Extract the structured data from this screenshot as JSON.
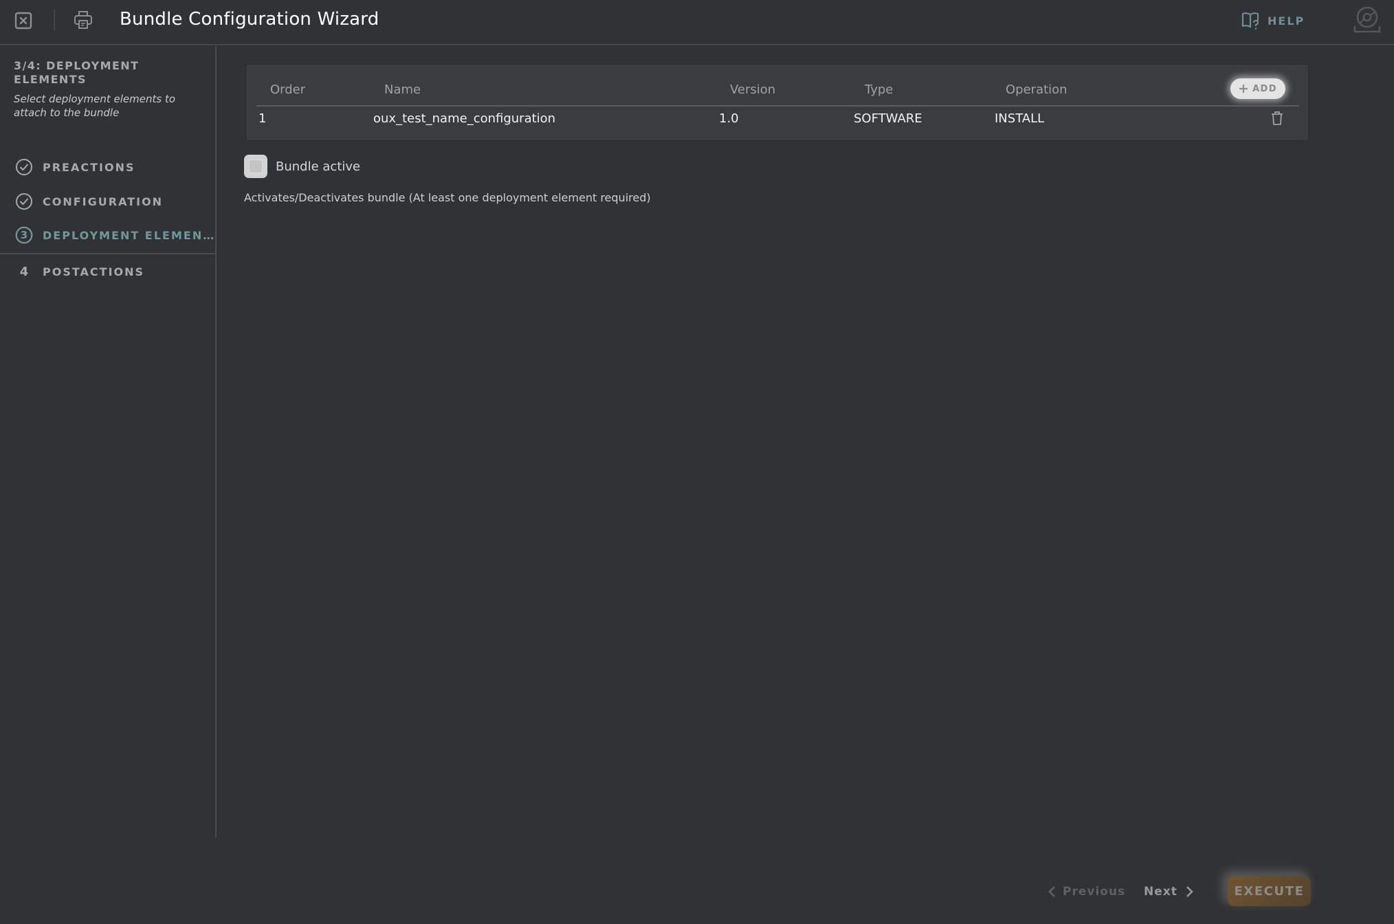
{
  "header": {
    "title": "Bundle Configuration Wizard",
    "help_label": "HELP",
    "icons": {
      "close": "close-icon",
      "print": "printer-icon",
      "help": "book-question-icon",
      "avatar": "user-avatar-icon"
    }
  },
  "sidebar": {
    "current_step_title": "3/4: DEPLOYMENT ELEMENTS",
    "current_step_description": "Select deployment elements to attach to the bundle",
    "steps": [
      {
        "number": "1",
        "label": "PREACTIONS",
        "state": "completed"
      },
      {
        "number": "2",
        "label": "CONFIGURATION",
        "state": "completed"
      },
      {
        "number": "3",
        "label": "DEPLOYMENT ELEMEN…",
        "state": "active"
      },
      {
        "number": "4",
        "label": "POSTACTIONS",
        "state": "pending"
      }
    ]
  },
  "table": {
    "columns": [
      "Order",
      "Name",
      "Version",
      "Type",
      "Operation"
    ],
    "add_label": "ADD",
    "rows": [
      {
        "order": "1",
        "name": "oux_test_name_configuration",
        "version": "1.0",
        "type": "SOFTWARE",
        "operation": "INSTALL"
      }
    ]
  },
  "bundle_active": {
    "label": "Bundle active",
    "checked": false,
    "hint": "Activates/Deactivates bundle (At least one deployment element required)"
  },
  "footer": {
    "previous_label": "Previous",
    "next_label": "Next",
    "execute_label": "EXECUTE"
  },
  "colors": {
    "background": "#313235",
    "accent_teal": "#6e9a9c",
    "execute": "#6f5430"
  }
}
